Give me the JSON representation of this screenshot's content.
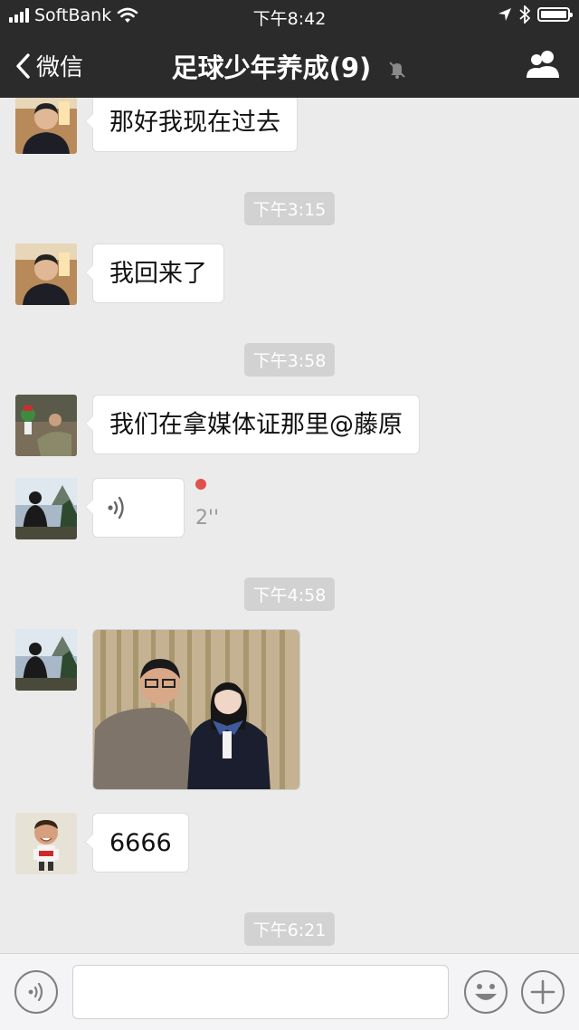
{
  "status_bar": {
    "carrier": "SoftBank",
    "time": "下午8:42"
  },
  "nav": {
    "back_label": "微信",
    "title": "足球少年养成(9)"
  },
  "messages": [
    {
      "type": "text",
      "text": "那好我现在过去"
    },
    {
      "type": "timestamp",
      "text": "下午3:15"
    },
    {
      "type": "text",
      "text": "我回来了"
    },
    {
      "type": "timestamp",
      "text": "下午3:58"
    },
    {
      "type": "text",
      "text": "我们在拿媒体证那里@藤原"
    },
    {
      "type": "voice",
      "duration": "2''",
      "unread": true
    },
    {
      "type": "timestamp",
      "text": "下午4:58"
    },
    {
      "type": "image"
    },
    {
      "type": "text",
      "text": "6666"
    },
    {
      "type": "timestamp",
      "text": "下午6:21"
    }
  ],
  "input_bar": {
    "value": ""
  },
  "colors": {
    "bar_background": "#2b2b2b",
    "chat_background": "#ebebeb",
    "unread_dot": "#e0504d"
  }
}
